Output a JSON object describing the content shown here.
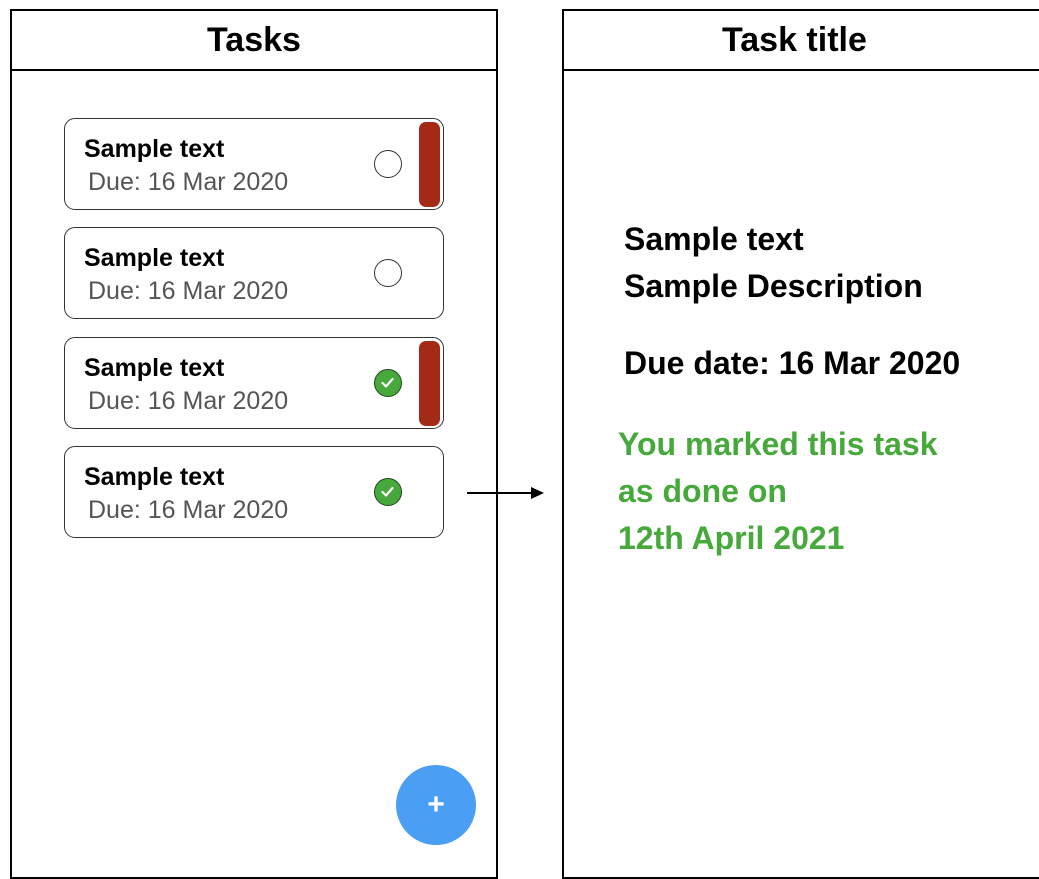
{
  "list_screen": {
    "title": "Tasks",
    "tasks": [
      {
        "title": "Sample text",
        "due": "Due: 16 Mar 2020",
        "done": false,
        "flagged": true
      },
      {
        "title": "Sample text",
        "due": "Due: 16 Mar 2020",
        "done": false,
        "flagged": false
      },
      {
        "title": "Sample text",
        "due": "Due: 16 Mar 2020",
        "done": true,
        "flagged": true
      },
      {
        "title": "Sample text",
        "due": "Due: 16 Mar 2020",
        "done": true,
        "flagged": false
      }
    ],
    "add_button_label": "+"
  },
  "detail_screen": {
    "title": "Task title",
    "task_name": "Sample text",
    "description": "Sample Description",
    "due_date": "Due date: 16 Mar 2020",
    "done_message": [
      "You marked this task",
      "as done on",
      "12th April 2021"
    ]
  },
  "colors": {
    "priority_flag": "#a32a17",
    "done_check": "#47a83b",
    "fab": "#4a9ef3",
    "done_text": "#47a83b"
  },
  "icons": {
    "check": "check-icon",
    "add": "plus-icon"
  }
}
